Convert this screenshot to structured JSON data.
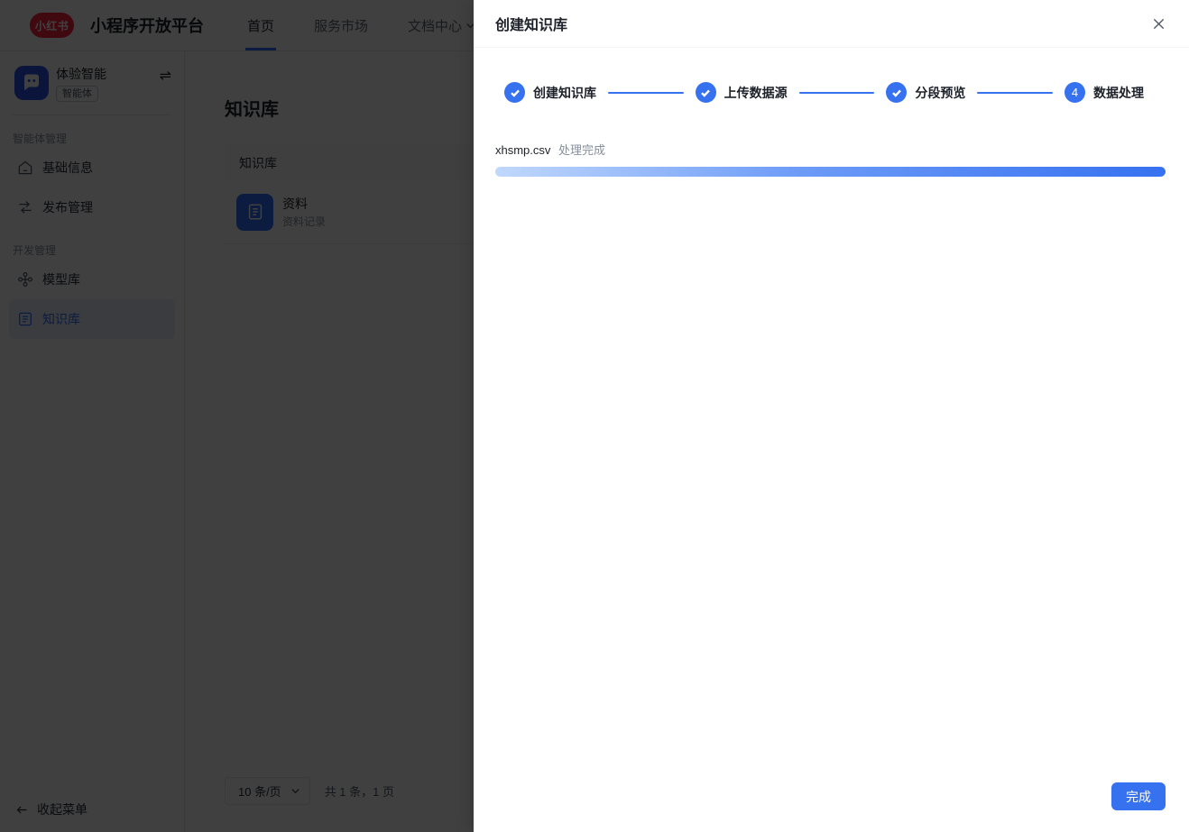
{
  "navbar": {
    "logo_text": "小红书",
    "title": "小程序开放平台",
    "items": [
      {
        "label": "首页",
        "active": true
      },
      {
        "label": "服务市场",
        "active": false
      },
      {
        "label": "文档中心",
        "active": false,
        "has_dropdown": true
      }
    ]
  },
  "sidebar": {
    "profile": {
      "name": "体验智能",
      "badge": "智能体"
    },
    "sections": [
      {
        "label": "智能体管理",
        "items": [
          {
            "label": "基础信息",
            "icon": "home-icon"
          },
          {
            "label": "发布管理",
            "icon": "publish-icon"
          }
        ]
      },
      {
        "label": "开发管理",
        "items": [
          {
            "label": "模型库",
            "icon": "model-icon"
          },
          {
            "label": "知识库",
            "icon": "knowledge-icon",
            "active": true
          }
        ]
      }
    ],
    "collapse_label": "收起菜单"
  },
  "main": {
    "page_title": "知识库",
    "table": {
      "header": "知识库",
      "rows": [
        {
          "title": "资料",
          "subtitle": "资料记录"
        }
      ]
    },
    "pagination": {
      "page_size": "10 条/页",
      "summary": "共 1 条，1 页"
    }
  },
  "drawer": {
    "title": "创建知识库",
    "steps": [
      {
        "label": "创建知识库",
        "state": "done"
      },
      {
        "label": "上传数据源",
        "state": "done"
      },
      {
        "label": "分段预览",
        "state": "done"
      },
      {
        "label": "数据处理",
        "state": "current",
        "number": "4"
      }
    ],
    "file": {
      "name": "xhsmp.csv",
      "status": "处理完成",
      "progress_percent": 100
    },
    "finish_button": "完成"
  },
  "colors": {
    "primary": "#3671f0",
    "logo_red": "#ff2442",
    "active_item_text": "#3370ff",
    "progress_gradient_start": "#c0d8fc",
    "progress_gradient_end": "#3671f0",
    "overlay": "rgba(0,0,0,0.75)"
  }
}
